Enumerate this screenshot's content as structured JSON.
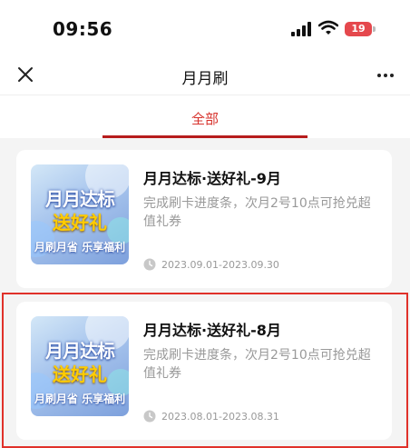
{
  "status_bar": {
    "time": "09:56",
    "battery": "19"
  },
  "nav": {
    "title": "月月刷"
  },
  "tabs": [
    {
      "label": "全部",
      "active": true
    }
  ],
  "accent_color": "#d7322c",
  "promos": [
    {
      "thumb_line1": "月月达标",
      "thumb_line2": "送好礼",
      "thumb_line3": "月刷月省 乐享福利",
      "title": "月月达标·送好礼-9月",
      "desc": "完成刷卡进度条，次月2号10点可抢兑超值礼券",
      "date_range": "2023.09.01-2023.09.30"
    },
    {
      "thumb_line1": "月月达标",
      "thumb_line2": "送好礼",
      "thumb_line3": "月刷月省 乐享福利",
      "title": "月月达标·送好礼-8月",
      "desc": "完成刷卡进度条，次月2号10点可抢兑超值礼券",
      "date_range": "2023.08.01-2023.08.31"
    }
  ]
}
